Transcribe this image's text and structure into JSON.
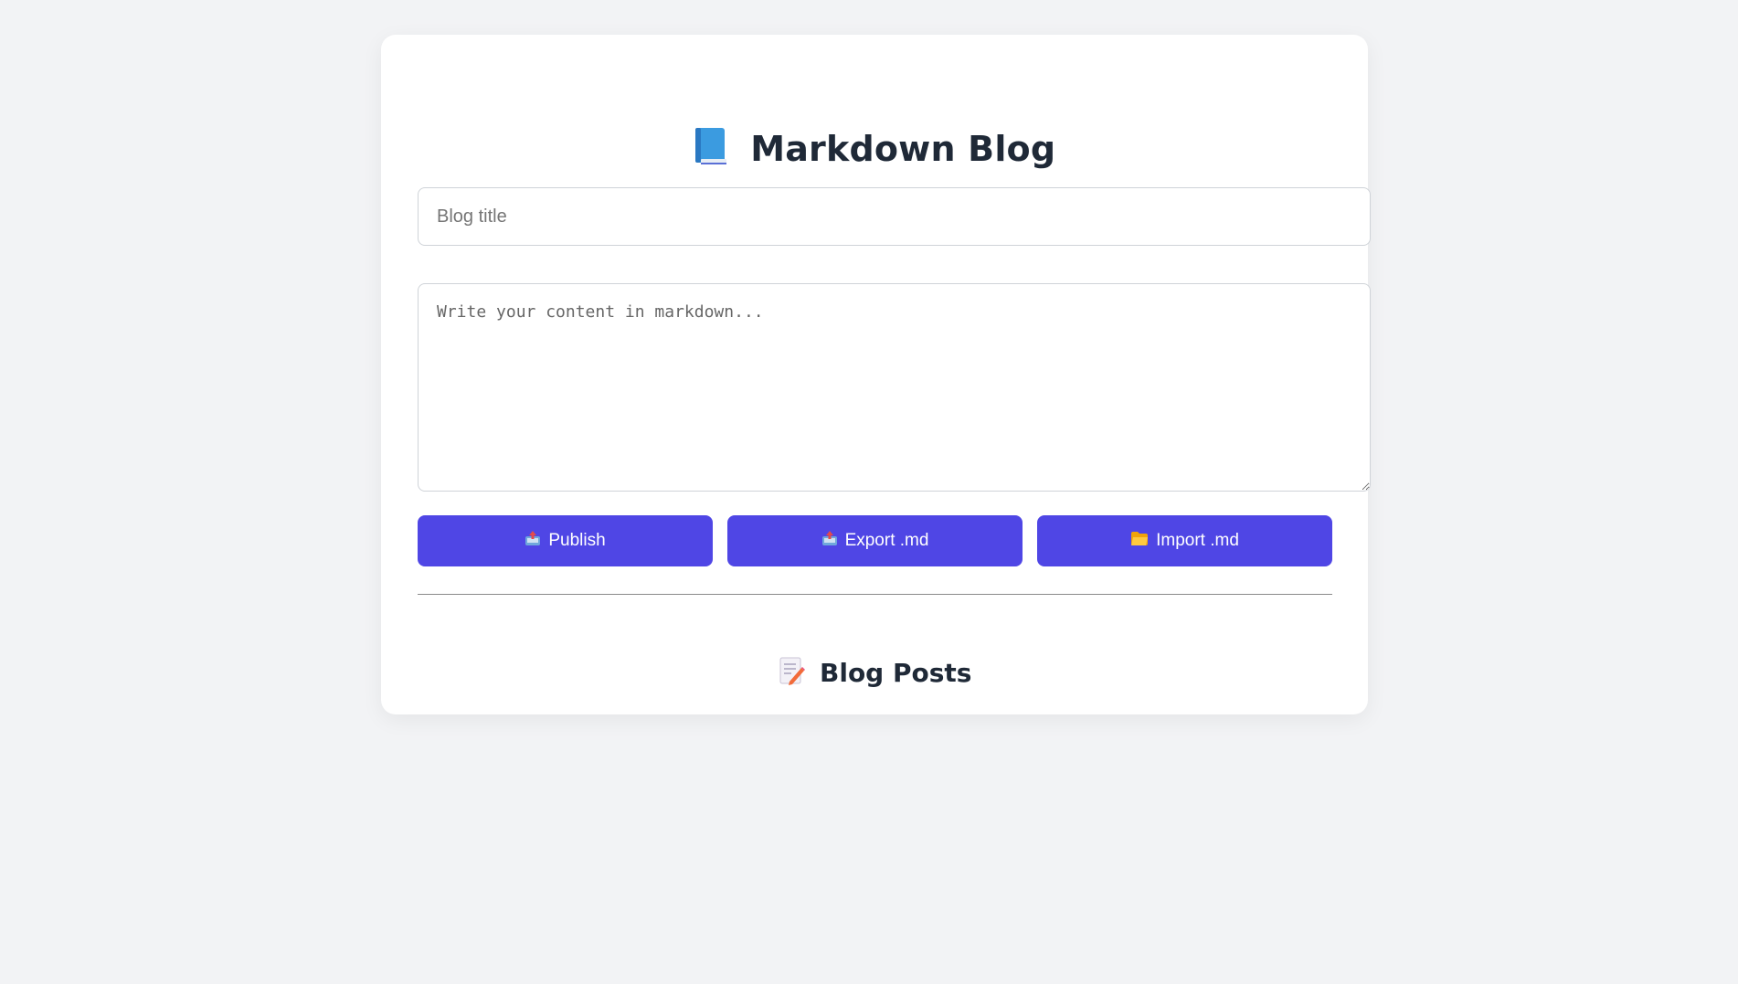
{
  "app": {
    "title": "Markdown Blog",
    "title_icon": "blue-book-icon"
  },
  "editor": {
    "title_placeholder": "Blog title",
    "title_value": "",
    "content_placeholder": "Write your content in markdown...",
    "content_value": ""
  },
  "actions": {
    "publish_label": "Publish",
    "publish_icon": "outbox-tray-icon",
    "export_label": "Export .md",
    "export_icon": "outbox-tray-icon",
    "import_label": "Import .md",
    "import_icon": "folder-icon"
  },
  "posts": {
    "heading": "Blog Posts",
    "heading_icon": "memo-icon",
    "items": []
  },
  "colors": {
    "accent": "#4f46e5",
    "page_background": "#f2f3f5",
    "card_background": "#ffffff",
    "heading_text": "#1f2937"
  }
}
